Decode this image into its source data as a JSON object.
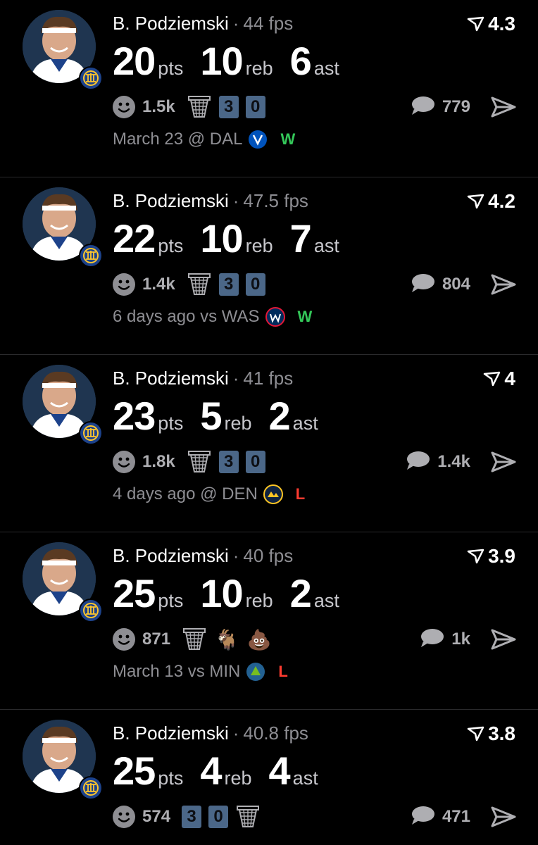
{
  "colors": {
    "background": "#000000",
    "text_primary": "#ffffff",
    "text_secondary": "#8e8e93",
    "tag_box": "#4b6788",
    "win": "#34c759",
    "loss": "#ff3b30"
  },
  "cards": [
    {
      "name": "B. Podziemski",
      "separator": "·",
      "fps": "44 fps",
      "rating": "4.3",
      "pts": "20",
      "pts_label": "pts",
      "reb": "10",
      "reb_label": "reb",
      "ast": "6",
      "ast_label": "ast",
      "reactions": "1.5k",
      "tags": [
        "hoop-icon",
        "3",
        "0"
      ],
      "comments": "779",
      "meta": "March 23 @ DAL",
      "opponent_icon": "mavericks-logo-icon",
      "result": "W",
      "result_color": "#34c759"
    },
    {
      "name": "B. Podziemski",
      "separator": "·",
      "fps": "47.5 fps",
      "rating": "4.2",
      "pts": "22",
      "pts_label": "pts",
      "reb": "10",
      "reb_label": "reb",
      "ast": "7",
      "ast_label": "ast",
      "reactions": "1.4k",
      "tags": [
        "hoop-icon",
        "3",
        "0"
      ],
      "comments": "804",
      "meta": "6 days ago vs WAS",
      "opponent_icon": "wizards-logo-icon",
      "result": "W",
      "result_color": "#34c759"
    },
    {
      "name": "B. Podziemski",
      "separator": "·",
      "fps": "41 fps",
      "rating": "4",
      "pts": "23",
      "pts_label": "pts",
      "reb": "5",
      "reb_label": "reb",
      "ast": "2",
      "ast_label": "ast",
      "reactions": "1.8k",
      "tags": [
        "hoop-icon",
        "3",
        "0"
      ],
      "comments": "1.4k",
      "meta": "4 days ago @ DEN",
      "opponent_icon": "nuggets-logo-icon",
      "result": "L",
      "result_color": "#ff3b30"
    },
    {
      "name": "B. Podziemski",
      "separator": "·",
      "fps": "40 fps",
      "rating": "3.9",
      "pts": "25",
      "pts_label": "pts",
      "reb": "10",
      "reb_label": "reb",
      "ast": "2",
      "ast_label": "ast",
      "reactions": "871",
      "tags": [
        "hoop-icon",
        "goat-emoji",
        "poop-emoji"
      ],
      "comments": "1k",
      "meta": "March 13 vs MIN",
      "opponent_icon": "timberwolves-logo-icon",
      "result": "L",
      "result_color": "#ff3b30"
    },
    {
      "name": "B. Podziemski",
      "separator": "·",
      "fps": "40.8 fps",
      "rating": "3.8",
      "pts": "25",
      "pts_label": "pts",
      "reb": "4",
      "reb_label": "reb",
      "ast": "4",
      "ast_label": "ast",
      "reactions": "574",
      "tags": [
        "3",
        "0",
        "hoop-icon"
      ],
      "comments": "471",
      "meta": "",
      "opponent_icon": "",
      "result": "",
      "result_color": "#ffffff"
    }
  ]
}
